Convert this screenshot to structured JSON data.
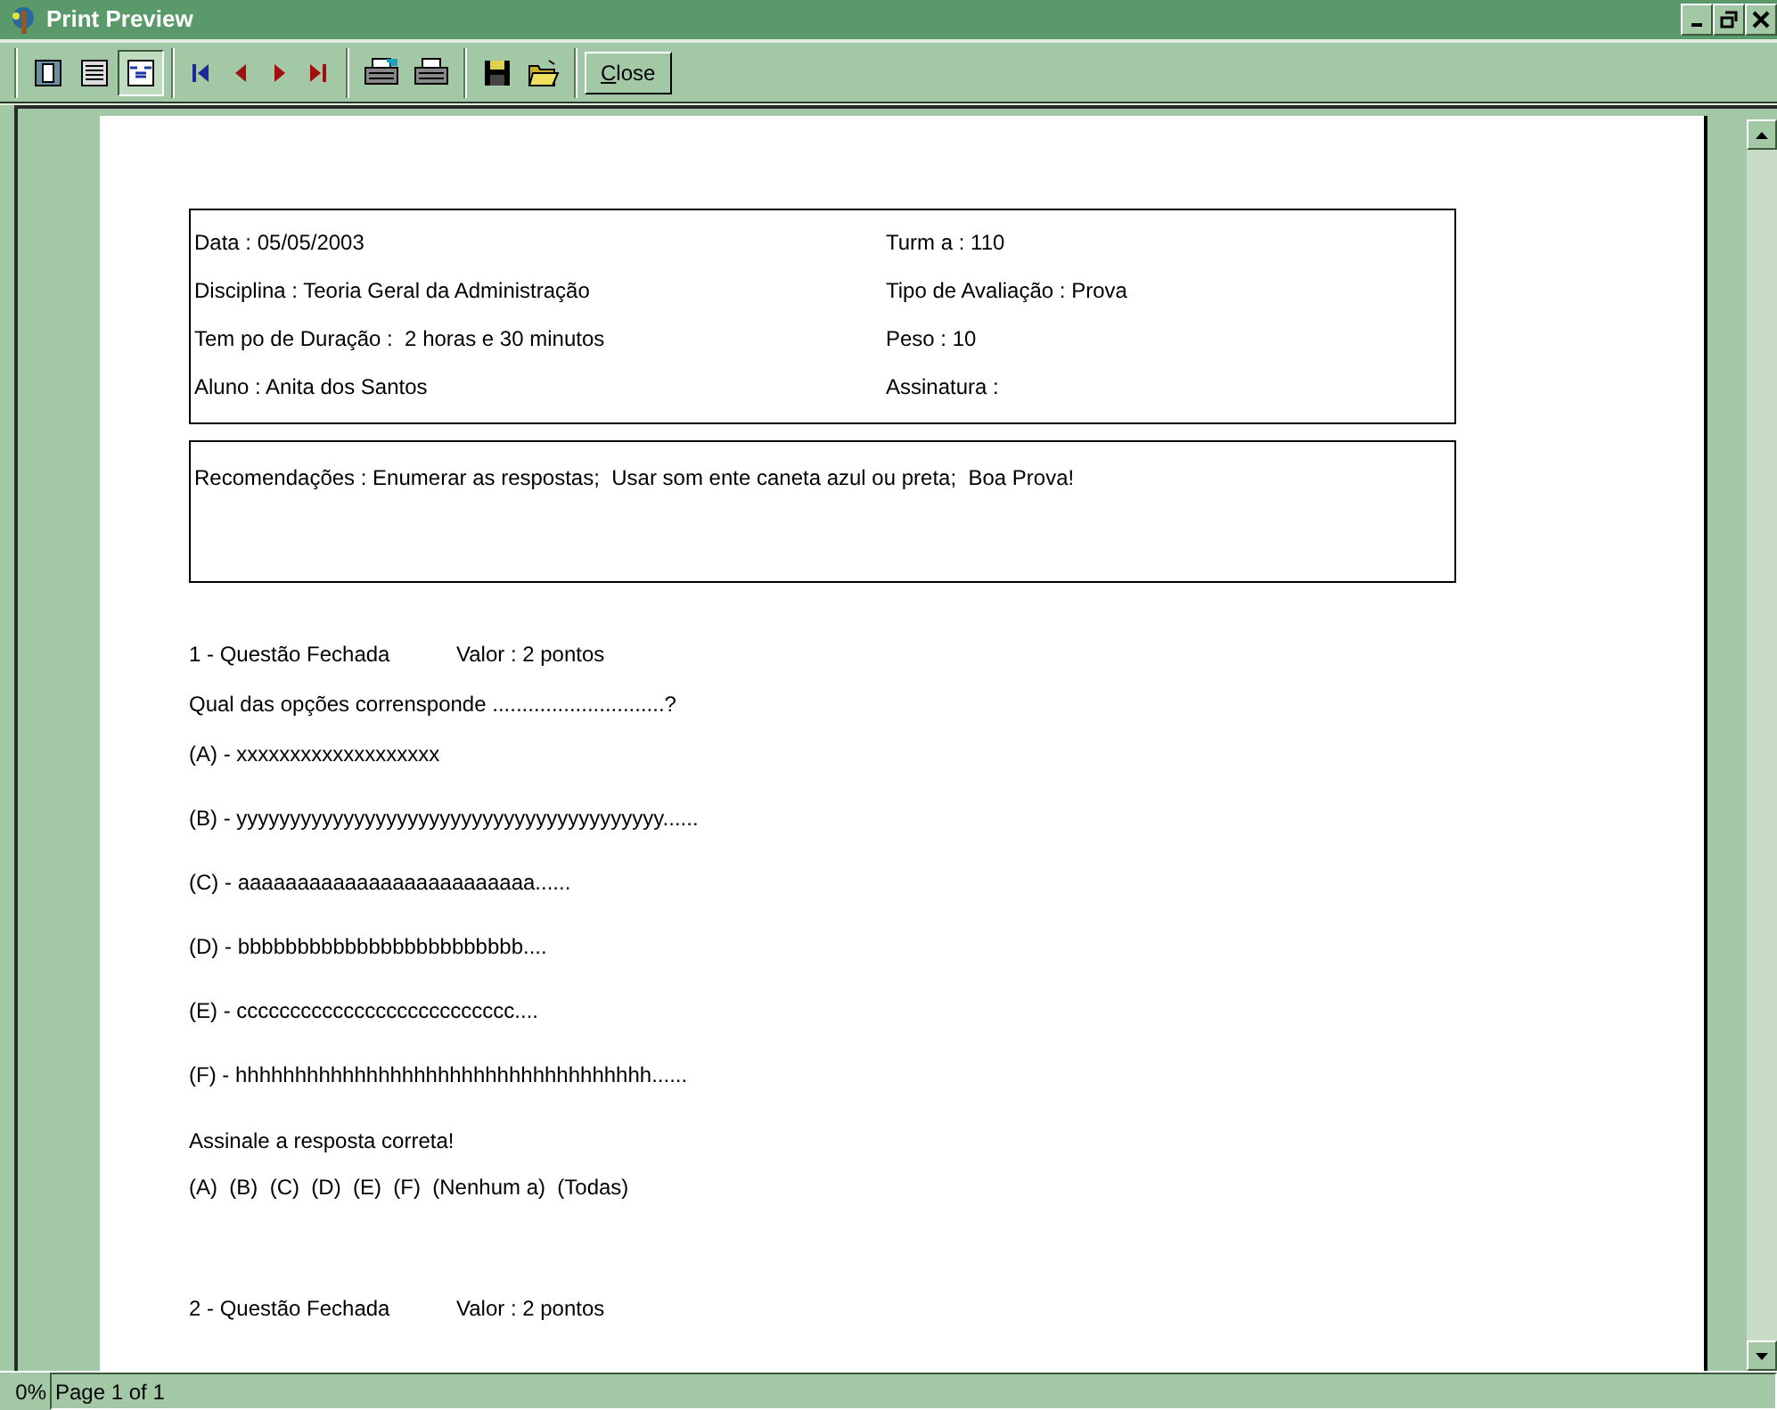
{
  "window": {
    "title": "Print Preview"
  },
  "toolbar": {
    "view_buttons": [
      {
        "kind": "one-page",
        "selected": false
      },
      {
        "kind": "lines",
        "selected": false
      },
      {
        "kind": "fit-width",
        "selected": true
      }
    ],
    "nav_buttons": [
      {
        "kind": "first"
      },
      {
        "kind": "prev"
      },
      {
        "kind": "next"
      },
      {
        "kind": "last"
      }
    ],
    "print_buttons": [
      {
        "kind": "setup"
      },
      {
        "kind": "print"
      }
    ],
    "file_buttons": [
      {
        "kind": "save"
      },
      {
        "kind": "open"
      }
    ],
    "close_button": "Close"
  },
  "document": {
    "header_fields": [
      {
        "left": "Data : 05/05/2003",
        "right": "Turm a : 110"
      },
      {
        "left": "Disciplina : Teoria Geral da Administração",
        "right": "Tipo de Avaliação : Prova"
      },
      {
        "left": "Tem po de Duração :  2 horas e 30 minutos",
        "right": "Peso : 10"
      },
      {
        "left": "Aluno : Anita dos Santos",
        "right": "Assinatura :"
      }
    ],
    "recommendations": "Recomendações : Enumerar as respostas;  Usar som ente caneta azul ou preta;  Boa Prova!",
    "questions": [
      {
        "title": "1 - Questão Fechada",
        "value": "Valor : 2 pontos",
        "prompt": "Qual das opções corrensponde .............................?",
        "options": [
          "(A) - xxxxxxxxxxxxxxxxxxx",
          "(B) - yyyyyyyyyyyyyyyyyyyyyyyyyyyyyyyyyyyyyyyy......",
          "(C) - aaaaaaaaaaaaaaaaaaaaaaaaa......",
          "(D) - bbbbbbbbbbbbbbbbbbbbbbbb....",
          "(E) - cccccccccccccccccccccccccc....",
          "(F) - hhhhhhhhhhhhhhhhhhhhhhhhhhhhhhhhhhh......"
        ],
        "instruction": "Assinale a resposta correta!",
        "choices": "(A)  (B)  (C)  (D)  (E)  (F)  (Nenhum a)  (Todas)"
      },
      {
        "title": "2 - Questão Fechada",
        "value": "Valor : 2 pontos"
      }
    ]
  },
  "status_bar": {
    "zoom": "0%",
    "page": "Page 1 of 1"
  }
}
